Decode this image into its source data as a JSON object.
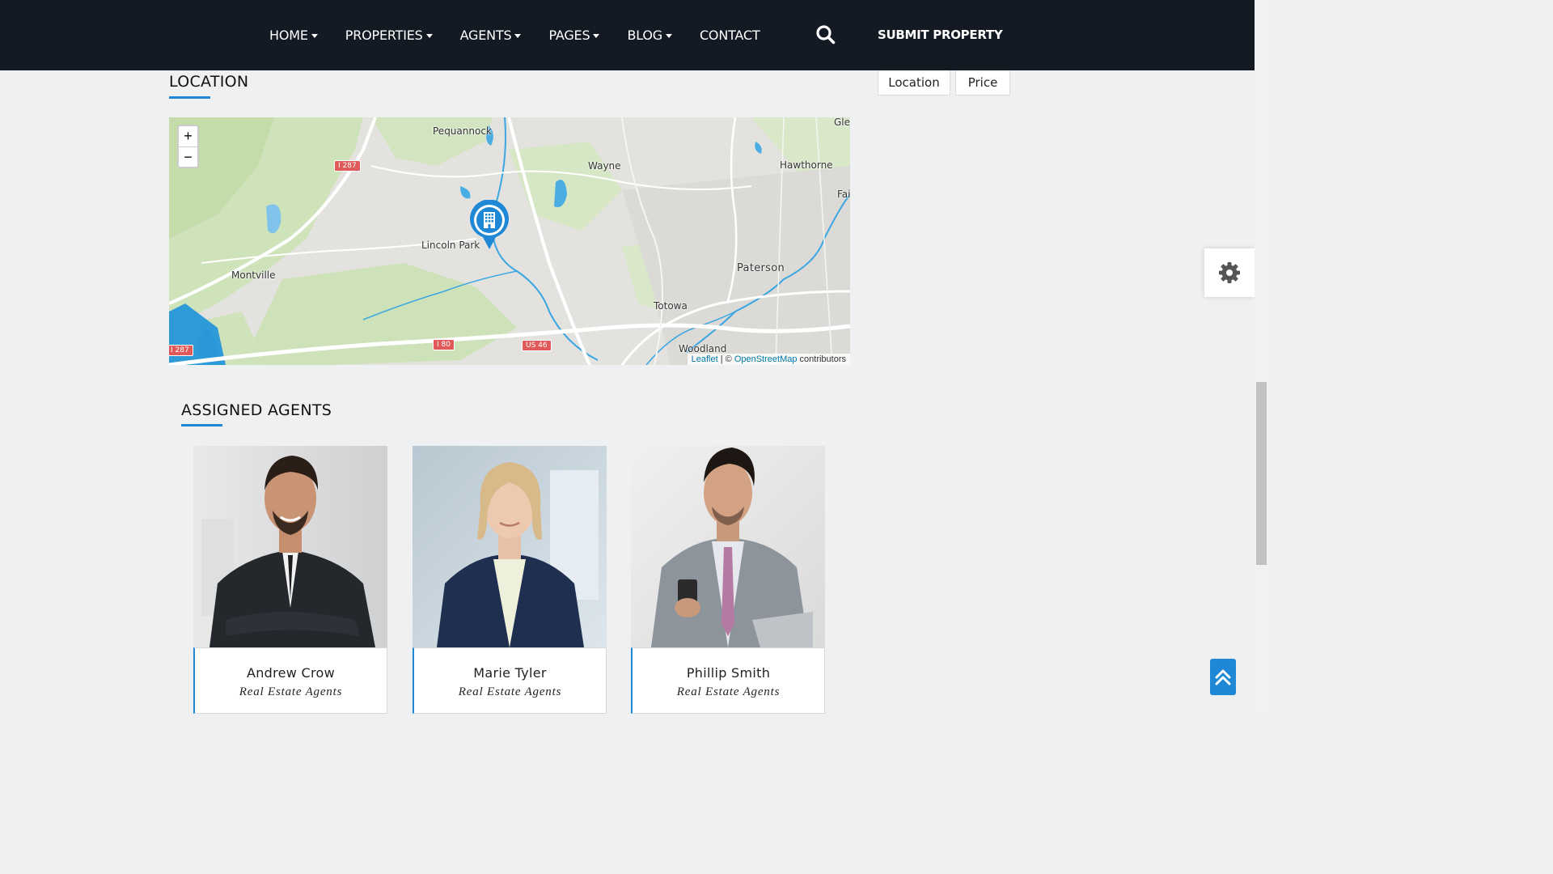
{
  "nav": {
    "items": [
      {
        "label": "HOME",
        "has_caret": true
      },
      {
        "label": "PROPERTIES",
        "has_caret": true
      },
      {
        "label": "AGENTS",
        "has_caret": true
      },
      {
        "label": "PAGES",
        "has_caret": true
      },
      {
        "label": "BLOG",
        "has_caret": true
      },
      {
        "label": "CONTACT",
        "has_caret": false
      }
    ],
    "search_icon": "search-icon",
    "submit_label": "SUBMIT PROPERTY"
  },
  "location": {
    "title": "LOCATION"
  },
  "side_tabs": [
    "Location",
    "Price"
  ],
  "map": {
    "zoom_in": "+",
    "zoom_out": "−",
    "labels": {
      "pequannock": "Pequannock",
      "wayne": "Wayne",
      "hawthorne": "Hawthorne",
      "glen": "Glen",
      "fair": "Fai",
      "lincoln_park": "Lincoln Park",
      "montville": "Montville",
      "paterson": "Paterson",
      "totowa": "Totowa",
      "woodland": "Woodland"
    },
    "shields": {
      "i287_top": "I 287",
      "i287_bottom": "I 287",
      "i80": "I 80",
      "us46": "US 46"
    },
    "attribution": {
      "leaflet": "Leaflet",
      "separator": " | © ",
      "osm": "OpenStreetMap",
      "suffix": " contributors"
    },
    "marker_icon": "building-icon"
  },
  "agents": {
    "title": "ASSIGNED AGENTS",
    "list": [
      {
        "name": "Andrew Crow",
        "role": "Real Estate Agents"
      },
      {
        "name": "Marie Tyler",
        "role": "Real Estate Agents"
      },
      {
        "name": "Phillip Smith",
        "role": "Real Estate Agents"
      }
    ]
  },
  "colors": {
    "accent": "#1e88d6",
    "topbar": "#131a24",
    "background": "#eff0f2"
  },
  "icons": {
    "settings": "gear-icon",
    "back_to_top": "double-chevron-up-icon"
  }
}
